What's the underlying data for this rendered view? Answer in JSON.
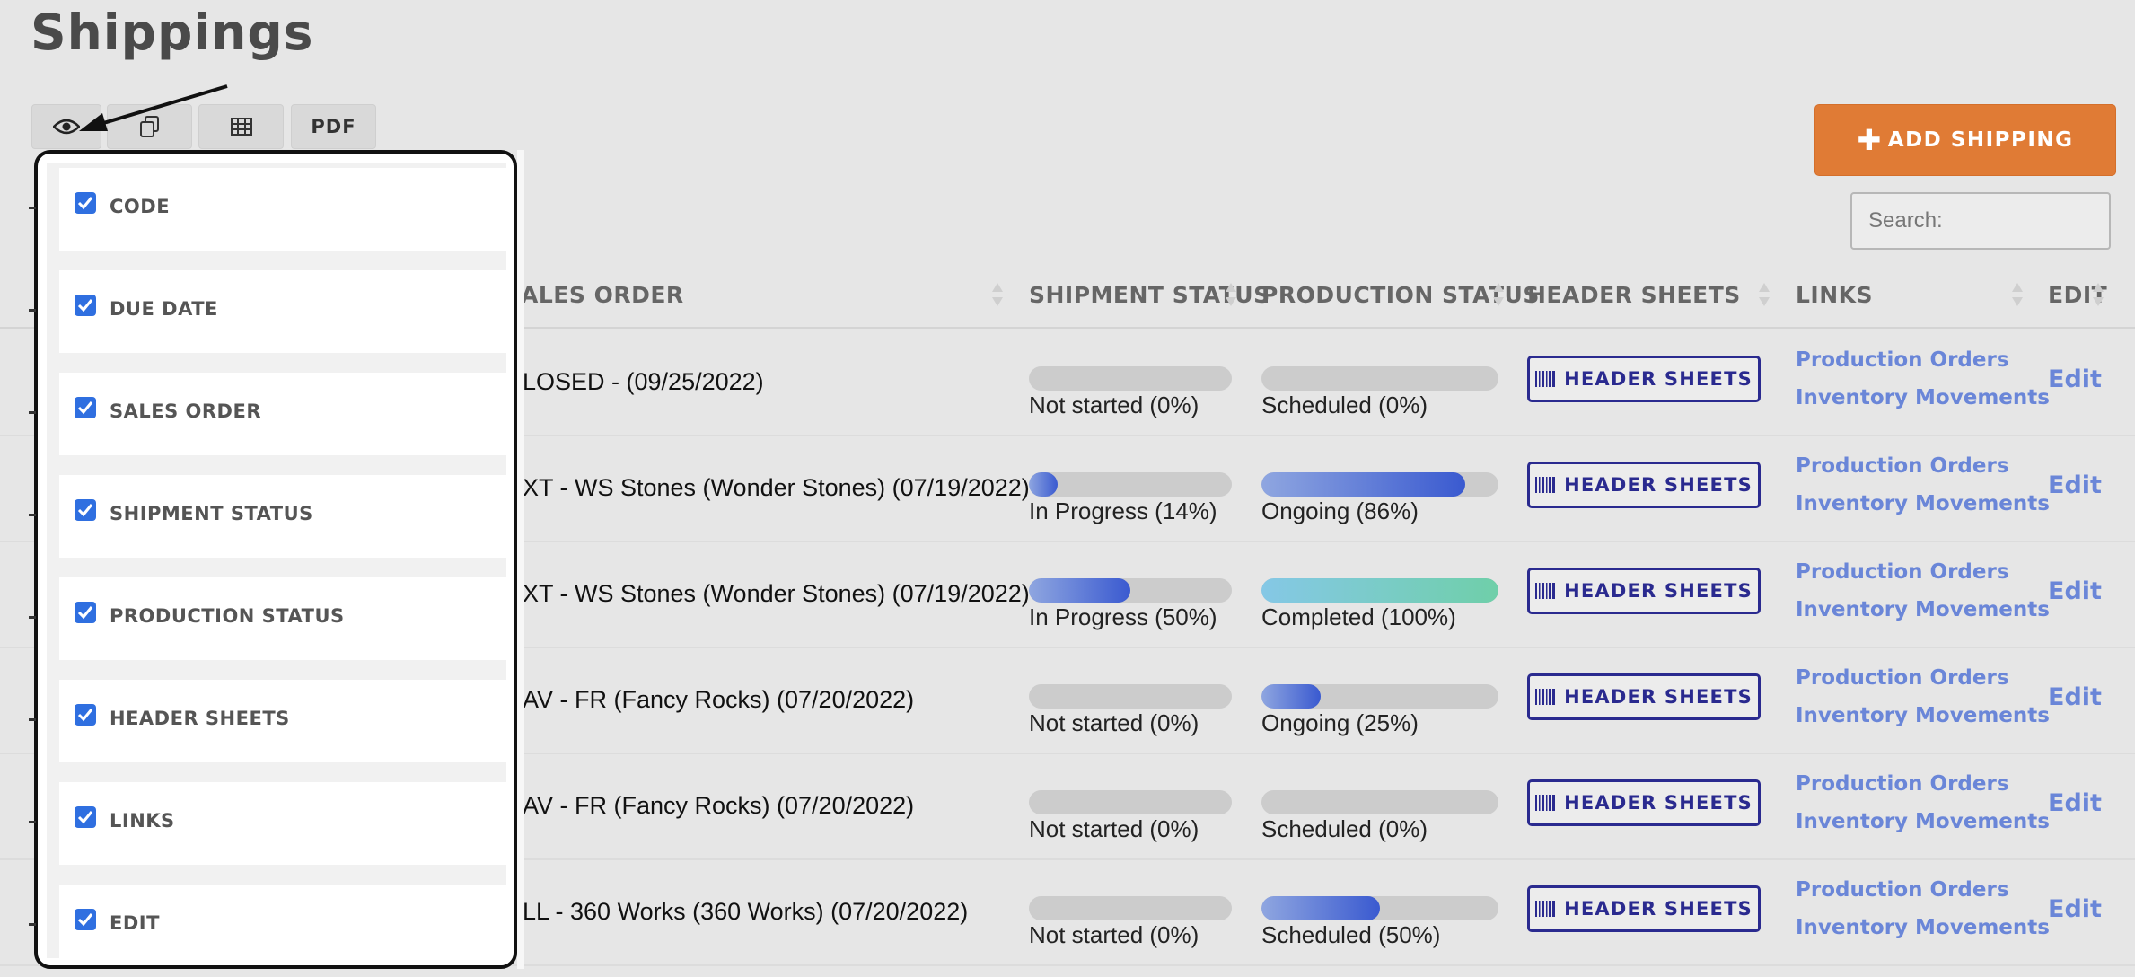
{
  "page": {
    "title": "Shippings"
  },
  "toolbar": {
    "pdf_label": "PDF"
  },
  "add_button": {
    "label": "ADD SHIPPING"
  },
  "search": {
    "placeholder": "Search:"
  },
  "columns": {
    "sales_order": "ALES ORDER",
    "shipment_status": "SHIPMENT STATUS",
    "production_status": "PRODUCTION STATUS",
    "header_sheets": "HEADER SHEETS",
    "links": "LINKS",
    "edit": "EDIT"
  },
  "rows": [
    {
      "sales_order": "LOSED - (09/25/2022)",
      "shipment_label": "Not started (0%)",
      "shipment_progress": 0,
      "production_label": "Scheduled (0%)",
      "production_progress": 0,
      "production_style": "blue",
      "header_sheets": "HEADER SHEETS",
      "link1": "Production Orders",
      "link2": "Inventory Movements",
      "edit": "Edit"
    },
    {
      "sales_order": "XT - WS Stones (Wonder Stones) (07/19/2022)",
      "shipment_label": "In Progress (14%)",
      "shipment_progress": 14,
      "production_label": "Ongoing (86%)",
      "production_progress": 86,
      "production_style": "blue",
      "header_sheets": "HEADER SHEETS",
      "link1": "Production Orders",
      "link2": "Inventory Movements",
      "edit": "Edit"
    },
    {
      "sales_order": "XT - WS Stones (Wonder Stones) (07/19/2022)",
      "shipment_label": "In Progress (50%)",
      "shipment_progress": 50,
      "production_label": "Completed (100%)",
      "production_progress": 100,
      "production_style": "green",
      "header_sheets": "HEADER SHEETS",
      "link1": "Production Orders",
      "link2": "Inventory Movements",
      "edit": "Edit"
    },
    {
      "sales_order": "AV - FR (Fancy Rocks) (07/20/2022)",
      "shipment_label": "Not started (0%)",
      "shipment_progress": 0,
      "production_label": "Ongoing (25%)",
      "production_progress": 25,
      "production_style": "blue",
      "header_sheets": "HEADER SHEETS",
      "link1": "Production Orders",
      "link2": "Inventory Movements",
      "edit": "Edit"
    },
    {
      "sales_order": "AV - FR (Fancy Rocks) (07/20/2022)",
      "shipment_label": "Not started (0%)",
      "shipment_progress": 0,
      "production_label": "Scheduled (0%)",
      "production_progress": 0,
      "production_style": "blue",
      "header_sheets": "HEADER SHEETS",
      "link1": "Production Orders",
      "link2": "Inventory Movements",
      "edit": "Edit"
    },
    {
      "sales_order": "LL - 360 Works (360 Works) (07/20/2022)",
      "shipment_label": "Not started (0%)",
      "shipment_progress": 0,
      "production_label": "Scheduled (50%)",
      "production_progress": 50,
      "production_style": "blue",
      "header_sheets": "HEADER SHEETS",
      "link1": "Production Orders",
      "link2": "Inventory Movements",
      "edit": "Edit"
    }
  ],
  "column_visibility": {
    "items": [
      {
        "label": "CODE",
        "checked": true
      },
      {
        "label": "DUE DATE",
        "checked": true
      },
      {
        "label": "SALES ORDER",
        "checked": true
      },
      {
        "label": "SHIPMENT STATUS",
        "checked": true
      },
      {
        "label": "PRODUCTION STATUS",
        "checked": true
      },
      {
        "label": "HEADER SHEETS",
        "checked": true
      },
      {
        "label": "LINKS",
        "checked": true
      },
      {
        "label": "EDIT",
        "checked": true
      }
    ]
  },
  "colors": {
    "accent": "#e07b35",
    "link": "#6a86d8",
    "header_sheets": "#2a2a8f",
    "checkbox": "#2f6fe0"
  }
}
